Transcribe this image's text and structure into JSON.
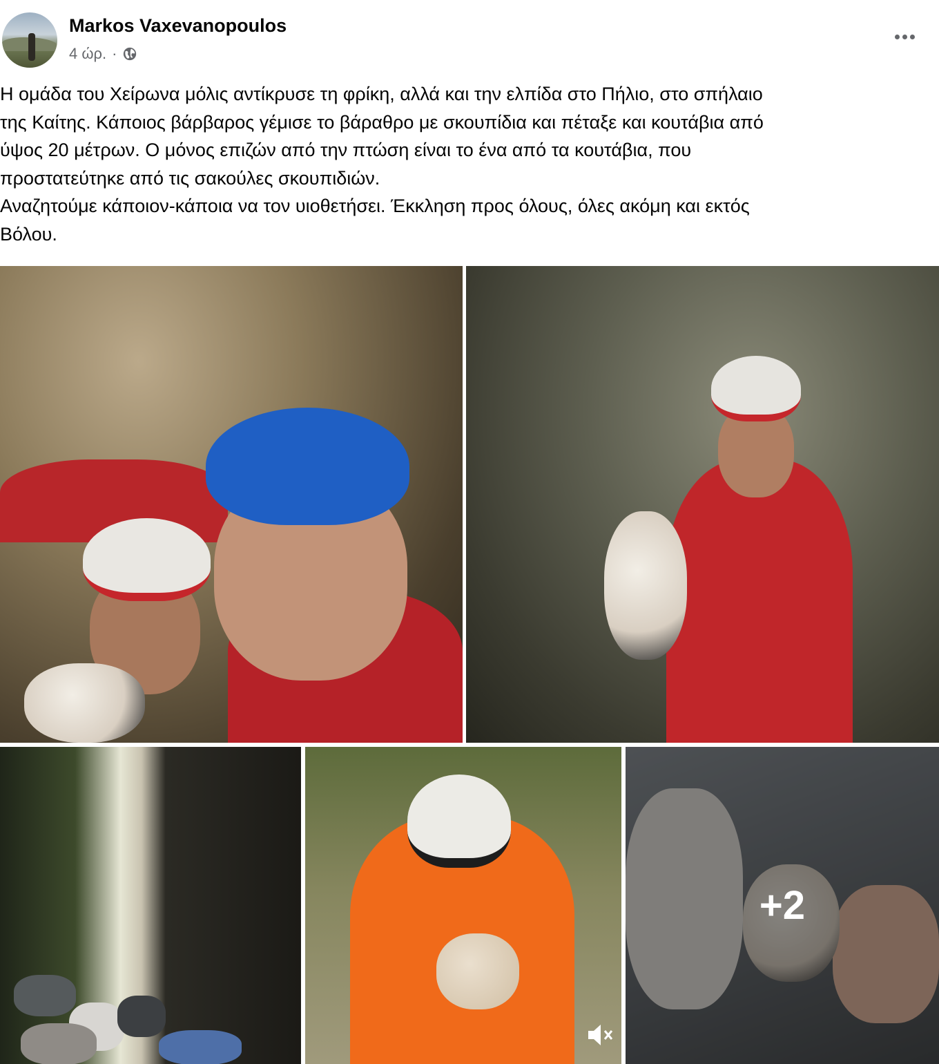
{
  "post": {
    "author": "Markos Vaxevanopoulos",
    "time": "4 ώρ.",
    "separator": "·",
    "privacy_icon": "globe-icon",
    "menu_icon": "more-options-icon",
    "text_lines": [
      "Η ομάδα του Χείρωνα μόλις αντίκρυσε τη φρίκη, αλλά και την ελπίδα στο Πήλιο, στο σπήλαιο",
      "της Καίτης. Κάποιος βάρβαρος γέμισε το βάραθρο με σκουπίδια και πέταξε και κουτάβια από",
      "ύψος 20 μέτρων. Ο μόνος επιζών από την πτώση είναι το ένα από τα κουτάβια, που",
      "προστατεύτηκε από τις σακούλες σκουπιδιών.",
      "Αναζητούμε κάποιον-κάποια να τον υιοθετήσει. Έκκληση προς όλους, όλες ακόμη και εκτός",
      "Βόλου."
    ]
  },
  "gallery": {
    "more_count": "+2",
    "video_icon": "muted-speaker-icon",
    "colors": {
      "helmet_blue": "#1f5fc4",
      "helmet_white": "#e9e7e2",
      "suit_red": "#c0262a",
      "suit_orange": "#f06a1a"
    }
  }
}
